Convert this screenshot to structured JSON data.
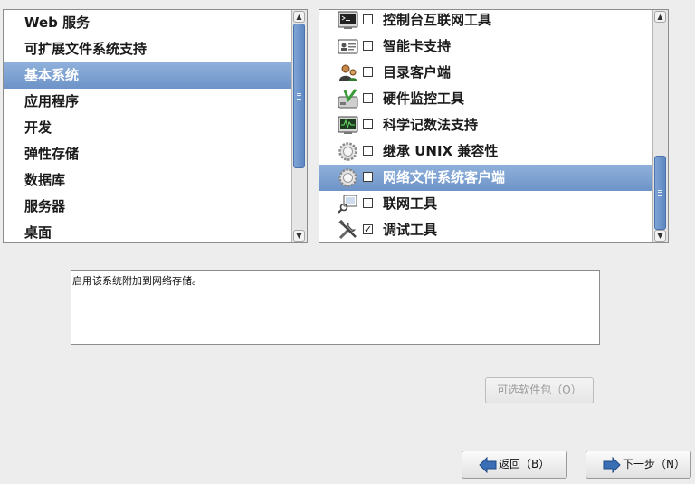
{
  "categories": {
    "items": [
      {
        "label": "Web 服务",
        "selected": false
      },
      {
        "label": "可扩展文件系统支持",
        "selected": false
      },
      {
        "label": "基本系统",
        "selected": true
      },
      {
        "label": "应用程序",
        "selected": false
      },
      {
        "label": "开发",
        "selected": false
      },
      {
        "label": "弹性存储",
        "selected": false
      },
      {
        "label": "数据库",
        "selected": false
      },
      {
        "label": "服务器",
        "selected": false
      },
      {
        "label": "桌面",
        "selected": false
      }
    ]
  },
  "groups": {
    "items": [
      {
        "label": "控制台互联网工具",
        "icon": "terminal-icon",
        "checked": false,
        "selected": false
      },
      {
        "label": "智能卡支持",
        "icon": "smartcard-icon",
        "checked": false,
        "selected": false
      },
      {
        "label": "目录客户端",
        "icon": "directory-users-icon",
        "checked": false,
        "selected": false
      },
      {
        "label": "硬件监控工具",
        "icon": "hardware-monitor-icon",
        "checked": false,
        "selected": false
      },
      {
        "label": "科学记数法支持",
        "icon": "scientific-monitor-icon",
        "checked": false,
        "selected": false
      },
      {
        "label": "继承 UNIX 兼容性",
        "icon": "gear-icon",
        "checked": false,
        "selected": false
      },
      {
        "label": "网络文件系统客户端",
        "icon": "gear-icon",
        "checked": false,
        "selected": true
      },
      {
        "label": "联网工具",
        "icon": "network-tool-icon",
        "checked": false,
        "selected": false
      },
      {
        "label": "调试工具",
        "icon": "tools-icon",
        "checked": true,
        "selected": false
      }
    ]
  },
  "description": "启用该系统附加到网络存储。",
  "buttons": {
    "optional_packages": "可选软件包（O）",
    "back": "返回（B）",
    "next": "下一步（N）"
  },
  "colors": {
    "selection": "#7a9fd2",
    "scroll_thumb": "#6f95c8",
    "background": "#ededed",
    "arrow_blue": "#3a6fb5"
  }
}
